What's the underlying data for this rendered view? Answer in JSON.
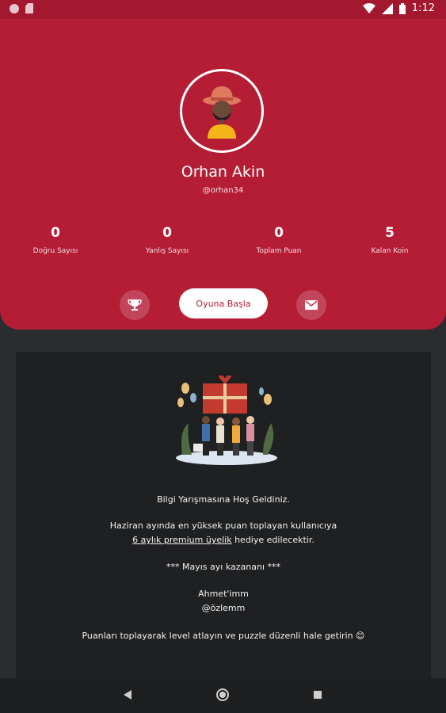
{
  "status_bar": {
    "time": "1:12"
  },
  "profile": {
    "name": "Orhan Akin",
    "handle": "@orhan34",
    "avatar_icon": "person-with-hat-avatar"
  },
  "stats": [
    {
      "value": "0",
      "label": "Doğru Sayısı"
    },
    {
      "value": "0",
      "label": "Yanlış Sayısı"
    },
    {
      "value": "0",
      "label": "Toplam Puan"
    },
    {
      "value": "5",
      "label": "Kalan Koin"
    }
  ],
  "actions": {
    "start_label": "Oyuna Başla",
    "left_icon": "trophy-icon",
    "right_icon": "mail-icon"
  },
  "message": {
    "welcome": "Bilgi Yarışmasına Hoş Geldiniz.",
    "line1": "Haziran ayında en yüksek puan toplayan kullanıcıya",
    "premium_link": "6 aylık premium üyelik",
    "line2_suffix": " hediye edilecektir.",
    "winner_header": "*** Mayıs ayı kazananı ***",
    "winner1": "Ahmet'imm",
    "winner2": "@özlemm",
    "tip": "Puanları toplayarak level atlayın ve puzzle düzenli hale getirin 😊"
  },
  "colors": {
    "primary": "#b51d35",
    "statusbar": "#a3182f",
    "card": "#1f2022",
    "background": "#2b2c2f"
  }
}
